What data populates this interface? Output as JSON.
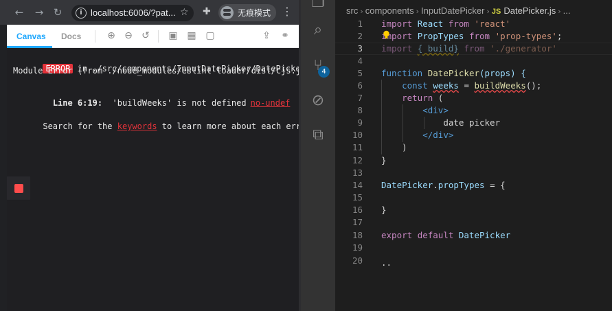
{
  "browser": {
    "url": "localhost:6006/?pat...",
    "incognito_label": "无痕模式"
  },
  "storybook": {
    "tabs": [
      "Canvas",
      "Docs"
    ],
    "error": {
      "badge": "ERROR",
      "path": "in ./src/components/InputDatePicker/DatePicker.js",
      "module_error": "Module Error (from ./node_modules/eslint-loader/dist/cjs.js):",
      "line_ref": "Line 6:19:",
      "message": "'buildWeeks' is not defined",
      "rule": "no-undef",
      "search_prefix": "Search for the",
      "search_link": "keywords",
      "search_suffix": "to learn more about each error."
    }
  },
  "editor": {
    "breadcrumb": [
      "src",
      "components",
      "InputDatePicker"
    ],
    "file_type": "JS",
    "file_name": "DatePicker.js",
    "scm_badge": "4",
    "line_numbers": [
      "1",
      "2",
      "3",
      "4",
      "5",
      "6",
      "7",
      "8",
      "9",
      "10",
      "11",
      "12",
      "13",
      "14",
      "15",
      "16",
      "17",
      "18",
      "19",
      "20"
    ],
    "current_line": "3",
    "code": {
      "l1": {
        "kw": "import",
        "name": "React",
        "from": "from",
        "str": "'react'",
        "end": ";"
      },
      "l2": {
        "kw": "import",
        "name": "PropTypes",
        "from": "from",
        "str": "'prop-types'",
        "end": ";"
      },
      "l3": {
        "kw": "import",
        "name": "{ build}",
        "from": "from",
        "str": "'./generator'"
      },
      "l5": {
        "kw": "function",
        "name": "DatePicker",
        "params": "(props) {"
      },
      "l6": {
        "kw": "const",
        "name": "weeks",
        "eq": "=",
        "call": "buildWeeks",
        "end": "();"
      },
      "l7": {
        "kw": "return",
        "end": "("
      },
      "l8": {
        "tag": "<div>"
      },
      "l9": {
        "text": "date picker"
      },
      "l10": {
        "tag": "</div>"
      },
      "l11": {
        "text": ")"
      },
      "l12": {
        "text": "}"
      },
      "l14": {
        "name": "DatePicker",
        "dot": ".",
        "prop": "propTypes",
        "end": "= {"
      },
      "l16": {
        "text": "}"
      },
      "l18": {
        "kw1": "export",
        "kw2": "default",
        "name": "DatePicker"
      },
      "l20": {
        "text": ".."
      }
    }
  },
  "colors": {
    "accent_blue": "#1ea7fd",
    "error_red": "#e3333b",
    "keyword": "#c586c0",
    "function": "#dcdcaa",
    "string": "#ce9178"
  },
  "icons": [
    "back-icon",
    "forward-icon",
    "reload-icon",
    "info-icon",
    "star-icon",
    "puzzle-icon",
    "incognito-icon",
    "menu-icon",
    "zoom-in-icon",
    "zoom-out-icon",
    "zoom-reset-icon",
    "image-icon",
    "grid-icon",
    "frame-icon",
    "share-icon",
    "link-icon",
    "stop-icon",
    "files-icon",
    "search-icon",
    "source-control-icon",
    "debug-icon",
    "extensions-icon",
    "lightbulb-icon"
  ]
}
